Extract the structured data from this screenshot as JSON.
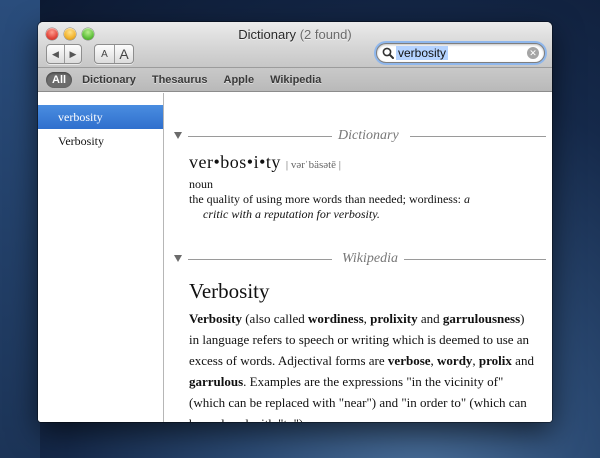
{
  "window": {
    "title": "Dictionary",
    "count": "(2 found)"
  },
  "toolbar": {
    "back_icon": "chevron-left-icon",
    "forward_icon": "chevron-right-icon",
    "font_smaller_label": "A",
    "font_larger_label": "A"
  },
  "search": {
    "value": "verbosity",
    "icon": "magnifier-icon",
    "accent": "#8fb7ec"
  },
  "scope": {
    "items": [
      "All",
      "Dictionary",
      "Thesaurus",
      "Apple",
      "Wikipedia"
    ],
    "active": "All"
  },
  "sidebar": {
    "items": [
      "verbosity",
      "Verbosity"
    ],
    "selected_color": "#3a7ad6"
  },
  "dictionary_section": {
    "label": "Dictionary",
    "headword": "ver•bos•i•ty",
    "pronunciation": "| vərˈbäsətē |",
    "part_of_speech": "noun",
    "definition": "the quality of using more words than needed; wordiness:",
    "example_start": "a",
    "example_rest": "critic with a reputation for verbosity."
  },
  "wikipedia_section": {
    "label": "Wikipedia",
    "title": "Verbosity",
    "body": [
      {
        "t": "Verbosity",
        "b": true
      },
      {
        "t": " (also called ",
        "b": false
      },
      {
        "t": "wordiness",
        "b": true
      },
      {
        "t": ", ",
        "b": false
      },
      {
        "t": "prolixity",
        "b": true
      },
      {
        "t": " and ",
        "b": false
      },
      {
        "t": "garrulousness",
        "b": true
      },
      {
        "t": ") in language refers to speech or writing which is deemed to use an excess of words. Adjectival forms are ",
        "b": false
      },
      {
        "t": "verbose",
        "b": true
      },
      {
        "t": ", ",
        "b": false
      },
      {
        "t": "wordy",
        "b": true
      },
      {
        "t": ", ",
        "b": false
      },
      {
        "t": "prolix",
        "b": true
      },
      {
        "t": " and ",
        "b": false
      },
      {
        "t": "garrulous",
        "b": true
      },
      {
        "t": ". Examples are the expressions \"in the vicinity of\" (which can be replaced with \"near\") and \"in order to\" (which can be replaced with \"to\").",
        "b": false
      }
    ]
  }
}
